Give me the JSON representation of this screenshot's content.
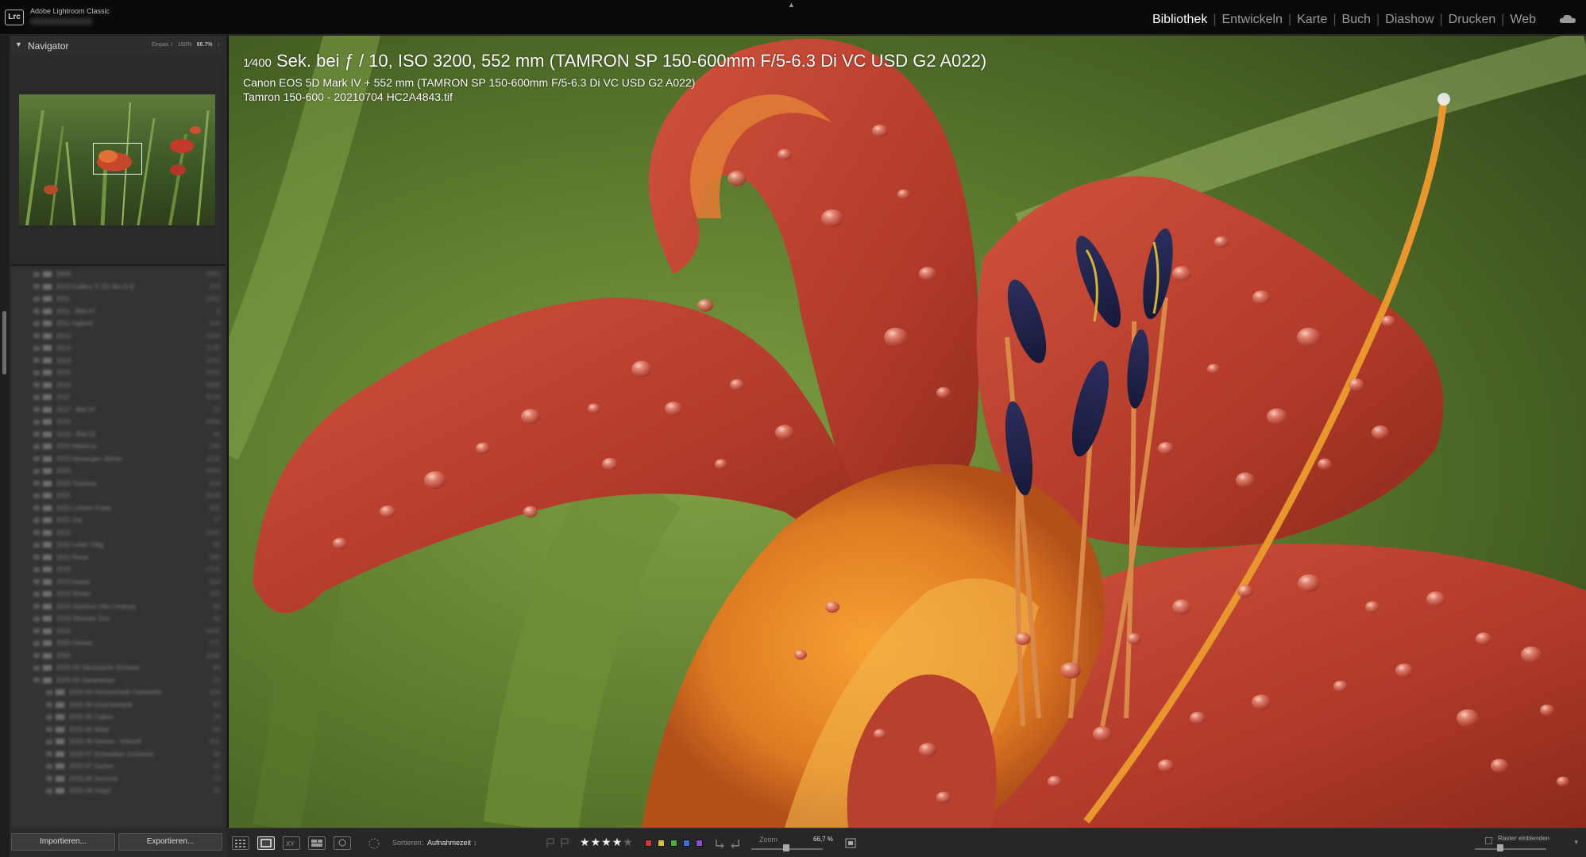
{
  "app": {
    "name": "Adobe Lightroom Classic",
    "logo": "Lrc"
  },
  "modules": [
    "Bibliothek",
    "Entwickeln",
    "Karte",
    "Buch",
    "Diashow",
    "Drucken",
    "Web"
  ],
  "active_module": "Bibliothek",
  "navigator": {
    "title": "Navigator",
    "zoom_options": [
      "Einpas ↕",
      "100%",
      "66.7%",
      "↕"
    ],
    "active_zoom": "66.7%"
  },
  "folders": [
    {
      "name": "2009",
      "count": "1002"
    },
    {
      "name": "2010 Gallery Tr ZO Bio-D-E",
      "count": "314"
    },
    {
      "name": "2011",
      "count": "1812"
    },
    {
      "name": "2011 - Bild 07",
      "count": "8"
    },
    {
      "name": "2011 Ingland",
      "count": "316"
    },
    {
      "name": "2012",
      "count": "1644"
    },
    {
      "name": "2013",
      "count": "2130"
    },
    {
      "name": "2014",
      "count": "1511"
    },
    {
      "name": "2015",
      "count": "2003"
    },
    {
      "name": "2016",
      "count": "1899"
    },
    {
      "name": "2017",
      "count": "2218"
    },
    {
      "name": "2017 - Bild 07",
      "count": "12"
    },
    {
      "name": "2018",
      "count": "2466"
    },
    {
      "name": "2018 - Bild 02",
      "count": "31"
    },
    {
      "name": "2019 Mallorca",
      "count": "248"
    },
    {
      "name": "2019 Norwegen Jänner",
      "count": "1102"
    },
    {
      "name": "2020",
      "count": "2904"
    },
    {
      "name": "2020 Toskana",
      "count": "418"
    },
    {
      "name": "2021",
      "count": "3018"
    },
    {
      "name": "2021 Lofoten Fotos",
      "count": "505"
    },
    {
      "name": "2021 Ost",
      "count": "77"
    },
    {
      "name": "2022",
      "count": "2661"
    },
    {
      "name": "2022 Lolah Tälig",
      "count": "92"
    },
    {
      "name": "2022 Reise",
      "count": "340"
    },
    {
      "name": "2023",
      "count": "2715"
    },
    {
      "name": "2023 Island",
      "count": "614"
    },
    {
      "name": "2023 Winter",
      "count": "203"
    },
    {
      "name": "2024 Seelöwe Ufer Limburg",
      "count": "58"
    },
    {
      "name": "2024 Silvester Zoo",
      "count": "41"
    },
    {
      "name": "2024",
      "count": "1930"
    },
    {
      "name": "2025 Ostsee",
      "count": "277"
    },
    {
      "name": "2025",
      "count": "1182"
    },
    {
      "name": "2025-03 Sächsische Schweiz",
      "count": "66"
    },
    {
      "name": "2025-04 Gartenfotos",
      "count": "25"
    },
    {
      "name": "2025-04 Hochschwab Gaststätte",
      "count": "134"
    },
    {
      "name": "2025-05 Griechenland",
      "count": "87"
    },
    {
      "name": "2025-05 Tulpen",
      "count": "19"
    },
    {
      "name": "2025-06 Wald",
      "count": "44"
    },
    {
      "name": "2025-06 Ostsee - Ankunft",
      "count": "201"
    },
    {
      "name": "2025-07 Schwalben Grünland",
      "count": "38"
    },
    {
      "name": "2025-07 Garten",
      "count": "22"
    },
    {
      "name": "2025-08 Sommer",
      "count": "73"
    },
    {
      "name": "2025-08 Hügel",
      "count": "15"
    }
  ],
  "buttons": {
    "import": "Importieren...",
    "export": "Exportieren..."
  },
  "info_overlay": {
    "shutter_frac": "1⁄400",
    "line1_rest": " Sek. bei ƒ / 10, ISO 3200, 552 mm (TAMRON SP 150-600mm F/5-6.3 Di VC USD G2 A022)",
    "line2": "Canon EOS 5D Mark IV + 552 mm (TAMRON SP 150-600mm F/5-6.3 Di VC USD G2 A022)",
    "line3": "Tamron 150-600 - 20210704 HC2A4843.tif"
  },
  "toolbar": {
    "sort_label": "Sortieren:",
    "sort_value": "Aufnahmezeit",
    "rating_stars": 4,
    "rating_max": 5,
    "color_labels": [
      "#c83b3b",
      "#d8c23a",
      "#4aa84a",
      "#3d6fd0",
      "#8a4fc8"
    ],
    "zoom_label": "Zoom",
    "zoom_value": "66,7 %",
    "raster_label": "Raster einblenden"
  }
}
